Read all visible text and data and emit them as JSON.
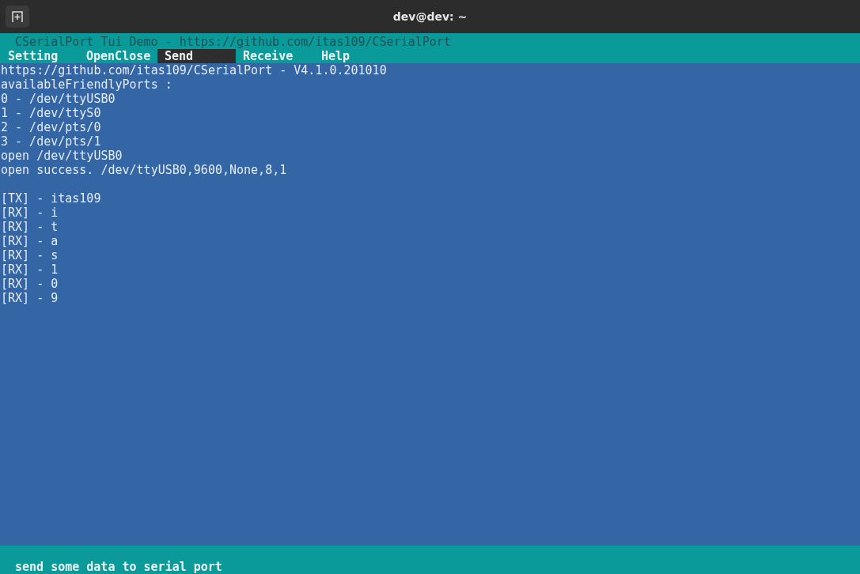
{
  "window": {
    "title": "dev@dev: ~"
  },
  "app": {
    "title": "CSerialPort Tui Demo - https://github.com/itas109/CSerialPort",
    "menu": [
      {
        "label": "Setting",
        "selected": false
      },
      {
        "label": "OpenClose",
        "selected": false
      },
      {
        "label": "Send",
        "selected": true
      },
      {
        "label": "Receive",
        "selected": false
      },
      {
        "label": "Help",
        "selected": false
      }
    ]
  },
  "terminal": {
    "log": [
      "https://github.com/itas109/CSerialPort - V4.1.0.201010",
      "availableFriendlyPorts :",
      "0 - /dev/ttyUSB0",
      "1 - /dev/ttyS0",
      "2 - /dev/pts/0",
      "3 - /dev/pts/1",
      "open /dev/ttyUSB0",
      "open success. /dev/ttyUSB0,9600,None,8,1"
    ],
    "messages": [
      "[TX] - itas109",
      "[RX] - i",
      "[RX] - t",
      "[RX] - a",
      "[RX] - s",
      "[RX] - 1",
      "[RX] - 0",
      "[RX] - 9"
    ]
  },
  "status_bar": {
    "text": "send some data to serial port"
  }
}
